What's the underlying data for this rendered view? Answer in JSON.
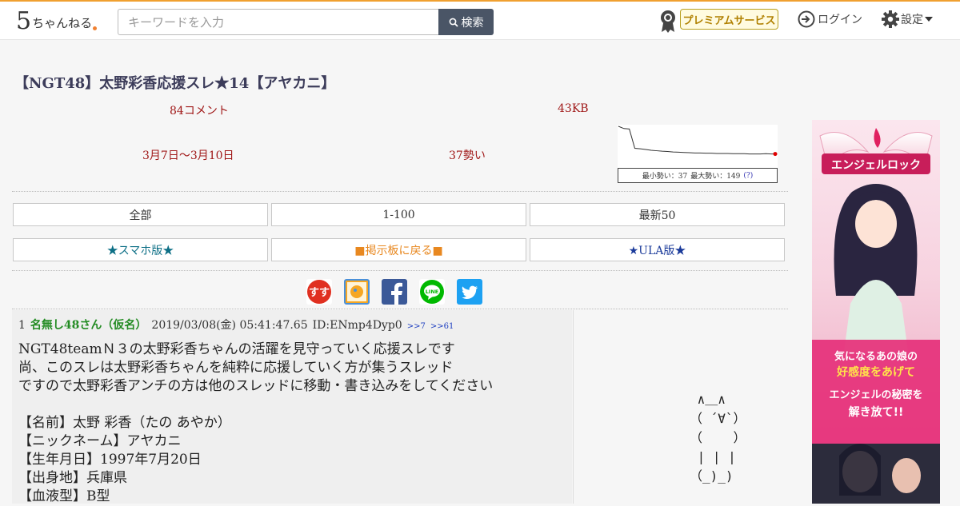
{
  "site": {
    "logo_five": "5",
    "logo_text": "ちゃんねる"
  },
  "search": {
    "placeholder": "キーワードを入力",
    "button_label": "検索"
  },
  "header": {
    "premium_label": "プレミアムサービス",
    "login_label": "ログイン",
    "settings_label": "設定"
  },
  "thread": {
    "title": "【NGT48】太野彩香応援スレ★14【アヤカニ】",
    "comments": "84コメント",
    "size": "43KB",
    "date_range": "3月7日〜3月10日",
    "momentum": "37勢い"
  },
  "graph": {
    "min_label": "最小勢い：37",
    "max_label": "最大勢い：149",
    "help_label": "(?)",
    "accent": "#e00000",
    "series": [
      149,
      140,
      138,
      60,
      58,
      55,
      52,
      50,
      48,
      47,
      45,
      44,
      43,
      42,
      41,
      41,
      40,
      40,
      39,
      39,
      39,
      38,
      38,
      38,
      37,
      37,
      37,
      38,
      37,
      37
    ]
  },
  "nav": {
    "row1": [
      "全部",
      "1-100",
      "最新50"
    ],
    "row2": [
      "★スマホ版★",
      "■掲示板に戻る■",
      "★ULA版★"
    ]
  },
  "share": {
    "icons": [
      "sumaho-icon",
      "bookmark-icon",
      "facebook-icon",
      "line-icon",
      "twitter-icon"
    ]
  },
  "post": {
    "number": "1",
    "name": "名無し48さん（仮名）",
    "date": "2019/03/08(金) 05:41:47.65",
    "id": "ID:ENmp4Dyp0",
    "ref1": ">>7",
    "ref2": ">>61",
    "body": "NGT48teamＮ３の太野彩香ちゃんの活躍を見守っていく応援スレです\n尚、このスレは太野彩香ちゃんを純粋に応援していく方が集うスレッド\nですので太野彩香アンチの方は他のスレッドに移動・書き込みをしてください\n\n【名前】太野 彩香（たの あやか）\n【ニックネーム】アヤカニ\n【生年月日】1997年7月20日\n【出身地】兵庫県\n【血液型】B型"
  },
  "aa": {
    "text": " ∧＿∧\n（ ´∀`）\n（    ）\n | | |\n（_)_)"
  },
  "ad": {
    "title": "エンジェルロック",
    "tagline_1": "気になるあの娘の",
    "tagline_2": "好感度をあげて",
    "tagline_3": "エンジェルの秘密を",
    "tagline_4": "解き放て!!"
  }
}
